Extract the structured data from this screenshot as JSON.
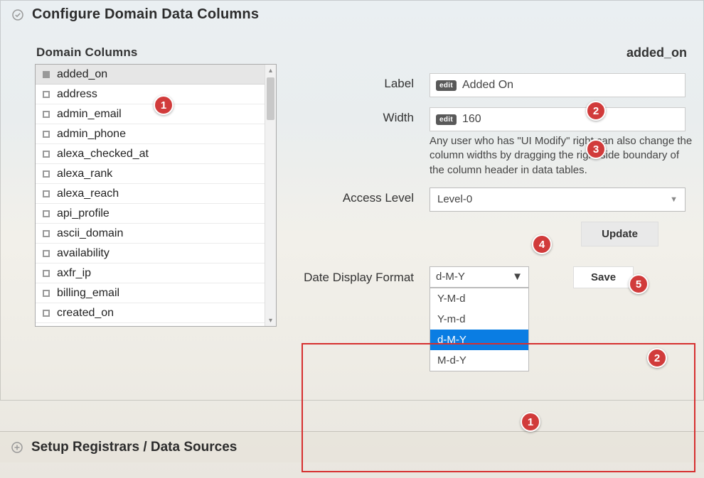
{
  "accordion1": {
    "title": "Configure Domain Data Columns"
  },
  "accordion2": {
    "title": "Setup Registrars / Data Sources"
  },
  "domain_columns": {
    "heading": "Domain Columns",
    "items": [
      "added_on",
      "address",
      "admin_email",
      "admin_phone",
      "alexa_checked_at",
      "alexa_rank",
      "alexa_reach",
      "api_profile",
      "ascii_domain",
      "availability",
      "axfr_ip",
      "billing_email",
      "created_on"
    ]
  },
  "details": {
    "selected_column": "added_on",
    "label_field": {
      "label": "Label",
      "value": "Added On",
      "badge": "edit"
    },
    "width_field": {
      "label": "Width",
      "value": "160",
      "badge": "edit",
      "help": "Any user who has \"UI Modify\" right can also change the column widths by dragging the right side boundary of the column header in data tables."
    },
    "access_level": {
      "label": "Access Level",
      "value": "Level-0"
    },
    "update_button": "Update"
  },
  "date_format": {
    "label": "Date Display Format",
    "selected": "d-M-Y",
    "options": [
      "Y-M-d",
      "Y-m-d",
      "d-M-Y",
      "M-d-Y"
    ],
    "save_button": "Save"
  },
  "callouts": {
    "c1": "1",
    "c2": "2",
    "c3": "3",
    "c4": "4",
    "c5": "5",
    "d1": "1",
    "d2": "2"
  }
}
